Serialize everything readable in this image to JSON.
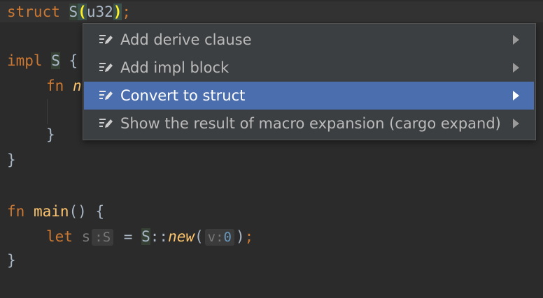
{
  "code": {
    "line1": {
      "kw": "struct",
      "name": "S",
      "paren_open": "(",
      "type": "u32",
      "paren_close": ")",
      "semi": ";"
    },
    "line2": {
      "kw": "impl",
      "name": "S",
      "brace": "{"
    },
    "line3": {
      "kw": "fn",
      "rest": "n"
    },
    "line5": {
      "brace": "}"
    },
    "line6": {
      "brace": "}"
    },
    "line8": {
      "kw": "fn",
      "name": "main",
      "params": "()",
      "brace": "{"
    },
    "line9": {
      "kw": "let",
      "var": "s",
      "type_hint": ":S",
      "eq": "=",
      "struct_name": "S",
      "path_sep": "::",
      "method": "new",
      "paren_open": "(",
      "param_hint": "v:",
      "arg": "0",
      "paren_close": ")",
      "semi": ";"
    },
    "line10": {
      "brace": "}"
    }
  },
  "popup": {
    "items": [
      {
        "label": "Add derive clause",
        "icon": "intention-edit-icon",
        "has_submenu": true
      },
      {
        "label": "Add impl block",
        "icon": "intention-edit-icon",
        "has_submenu": true
      },
      {
        "label": "Convert to struct",
        "icon": "intention-edit-icon",
        "has_submenu": true,
        "selected": true
      },
      {
        "label": "Show the result of macro expansion (cargo expand)",
        "icon": "intention-edit-icon",
        "has_submenu": true
      }
    ]
  },
  "colors": {
    "background": "#2b2b2b",
    "keyword": "#cc7832",
    "text": "#a9b7c6",
    "popup_bg": "#3c3f41",
    "popup_selected": "#4b6eaf",
    "number": "#6897bb"
  }
}
